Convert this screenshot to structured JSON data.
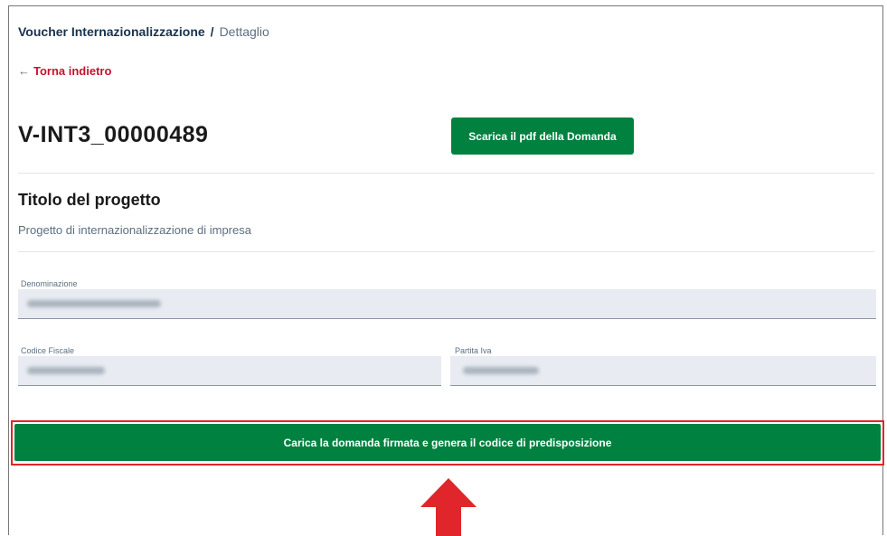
{
  "breadcrumb": {
    "parent": "Voucher Internazionalizzazione",
    "separator": "/",
    "current": "Dettaglio"
  },
  "back_link": {
    "arrow": "←",
    "label": "Torna indietro"
  },
  "record": {
    "id": "V-INT3_00000489"
  },
  "pdf_button": {
    "label": "Scarica il pdf della Domanda"
  },
  "project": {
    "title": "Titolo del progetto",
    "description": "Progetto di internazionalizzazione di impresa"
  },
  "fields": {
    "denominazione": {
      "label": "Denominazione"
    },
    "codice_fiscale": {
      "label": "Codice Fiscale"
    },
    "partita_iva": {
      "label": "Partita Iva"
    }
  },
  "main_button": {
    "label": "Carica la domanda firmata e genera il codice di predisposizione"
  },
  "colors": {
    "primary_green": "#00813f",
    "link_red": "#c8102e",
    "highlight_red": "#e0262a",
    "field_bg": "#e8ecf2"
  },
  "icons": {
    "back": "arrow-left-icon",
    "annotation": "red-up-arrow-icon"
  }
}
